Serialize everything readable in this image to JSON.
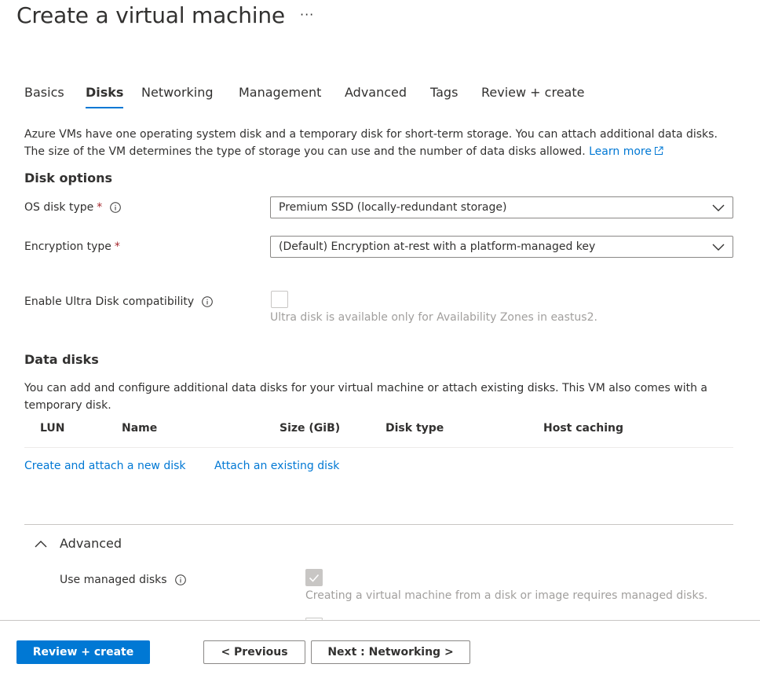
{
  "page": {
    "title": "Create a virtual machine",
    "more": "···"
  },
  "tabs": [
    {
      "label": "Basics"
    },
    {
      "label": "Disks"
    },
    {
      "label": "Networking"
    },
    {
      "label": "Management"
    },
    {
      "label": "Advanced"
    },
    {
      "label": "Tags"
    },
    {
      "label": "Review + create"
    }
  ],
  "intro": {
    "text": "Azure VMs have one operating system disk and a temporary disk for short-term storage. You can attach additional data disks. The size of the VM determines the type of storage you can use and the number of data disks allowed.",
    "learn_more": "Learn more"
  },
  "disk_options": {
    "heading": "Disk options",
    "os_disk_type": {
      "label": "OS disk type",
      "required": "*",
      "value": "Premium SSD (locally-redundant storage)"
    },
    "encryption_type": {
      "label": "Encryption type",
      "required": "*",
      "value": "(Default) Encryption at-rest with a platform-managed key"
    },
    "ultra_disk": {
      "label": "Enable Ultra Disk compatibility",
      "note": "Ultra disk is available only for Availability Zones in eastus2."
    }
  },
  "data_disks": {
    "heading": "Data disks",
    "description": "You can add and configure additional data disks for your virtual machine or attach existing disks. This VM also comes with a temporary disk.",
    "columns": [
      "LUN",
      "Name",
      "Size (GiB)",
      "Disk type",
      "Host caching"
    ],
    "create_link": "Create and attach a new disk",
    "attach_link": "Attach an existing disk"
  },
  "advanced": {
    "heading": "Advanced",
    "managed_disks": {
      "label": "Use managed disks",
      "note": "Creating a virtual machine from a disk or image requires managed disks."
    }
  },
  "footer": {
    "review_create": "Review + create",
    "previous": "< Previous",
    "next": "Next : Networking >"
  },
  "colors": {
    "accent": "#0078d4",
    "required": "#a4262c"
  }
}
